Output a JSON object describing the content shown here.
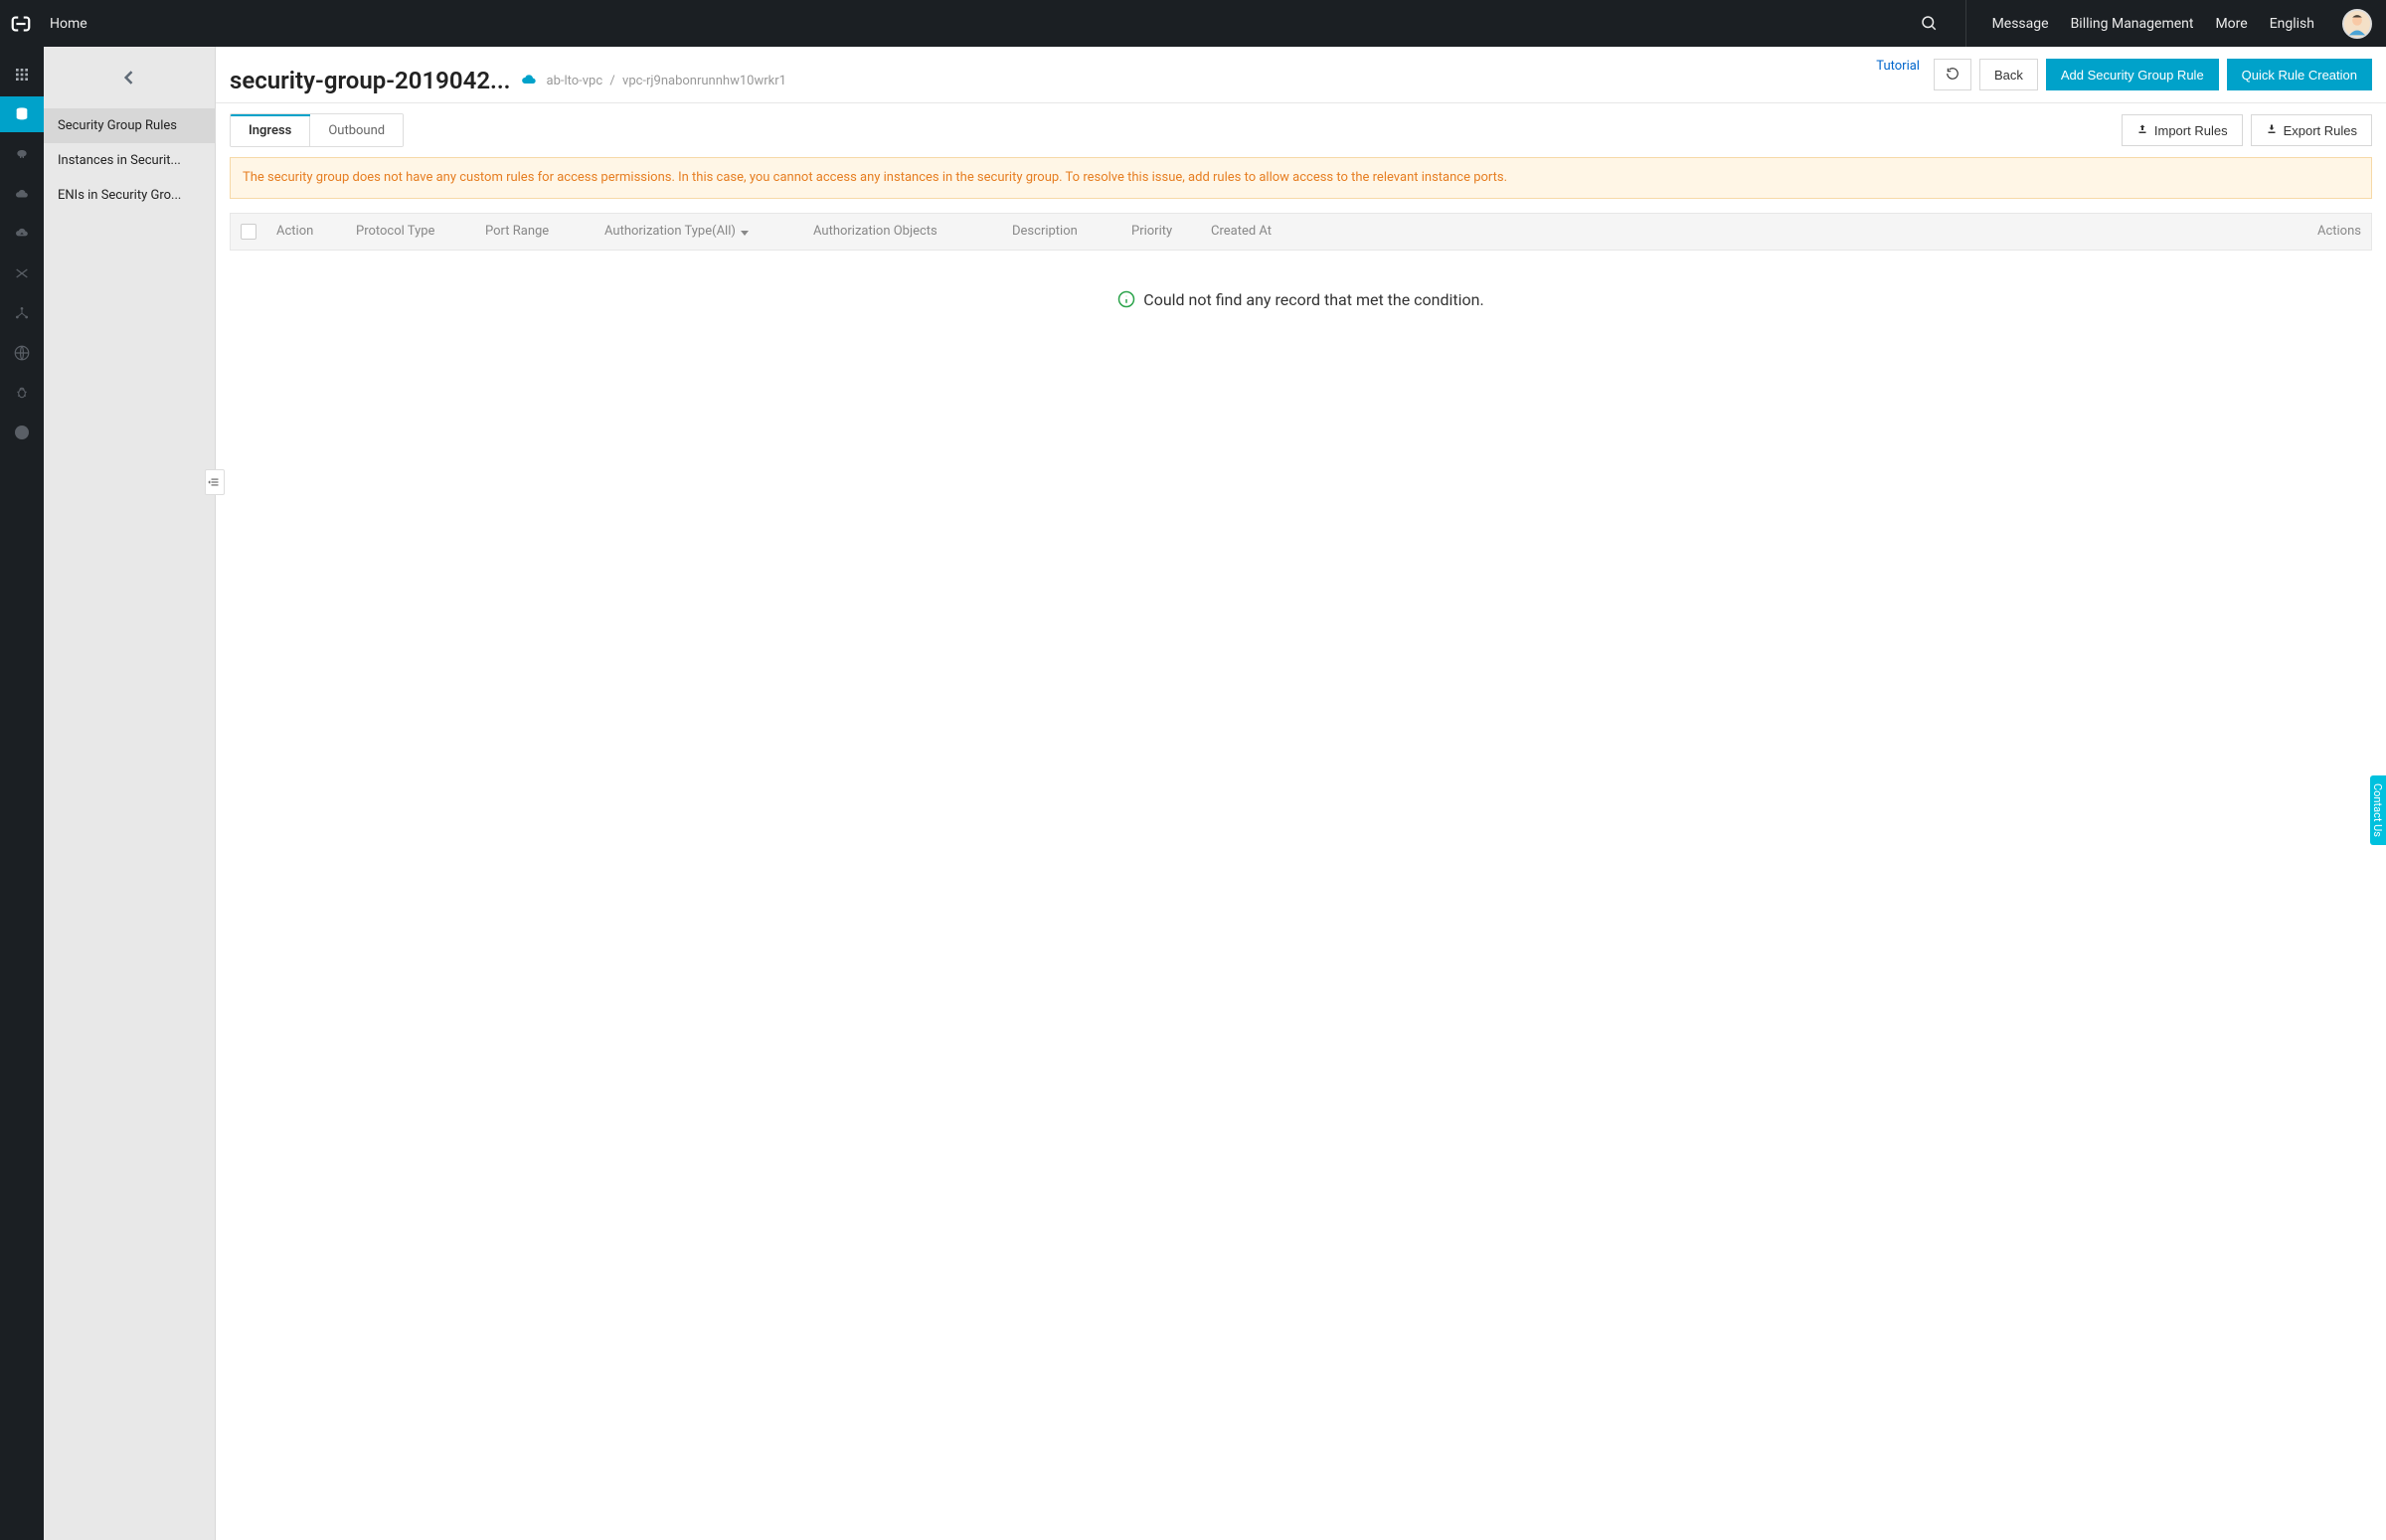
{
  "topbar": {
    "home": "Home",
    "message": "Message",
    "billing": "Billing Management",
    "more": "More",
    "lang": "English"
  },
  "sidepanel": {
    "items": [
      "Security Group Rules",
      "Instances in Securit...",
      "ENIs in Security Gro..."
    ]
  },
  "header": {
    "title": "security-group-2019042...",
    "vpc_name": "ab-lto-vpc",
    "vpc_id": "vpc-rj9nabonrunnhw10wrkr1",
    "tutorial": "Tutorial",
    "back": "Back",
    "add_rule": "Add Security Group Rule",
    "quick_rule": "Quick Rule Creation"
  },
  "tabs": {
    "ingress": "Ingress",
    "outbound": "Outbound"
  },
  "toolbar": {
    "import": "Import Rules",
    "export": "Export Rules"
  },
  "alert": {
    "text": "The security group does not have any custom rules for access permissions. In this case, you cannot access any instances in the security group. To resolve this issue, add rules to allow access to the relevant instance ports."
  },
  "columns": {
    "action": "Action",
    "protocol": "Protocol Type",
    "port": "Port Range",
    "auth_type": "Authorization Type(All)",
    "auth_obj": "Authorization Objects",
    "desc": "Description",
    "priority": "Priority",
    "created": "Created At",
    "actions": "Actions"
  },
  "empty": {
    "text": "Could not find any record that met the condition."
  },
  "contact": {
    "label": "Contact Us"
  }
}
